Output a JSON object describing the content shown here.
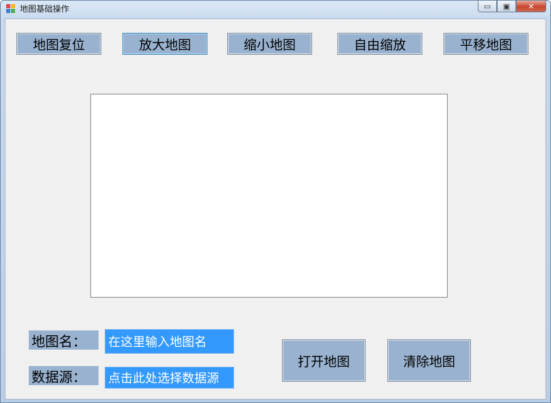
{
  "window": {
    "title": "地图基础操作",
    "min_glyph": "▭",
    "max_glyph": "▣",
    "close_glyph": "✕"
  },
  "toolbar": {
    "reset_label": "地图复位",
    "zoom_in_label": "放大地图",
    "zoom_out_label": "缩小地图",
    "free_zoom_label": "自由缩放",
    "pan_label": "平移地图"
  },
  "form": {
    "map_name_label": "地图名：",
    "map_name_value": "在这里输入地图名",
    "data_source_label": "数据源：",
    "data_source_value": "点击此处选择数据源"
  },
  "actions": {
    "open_label": "打开地图",
    "clear_label": "清除地图"
  },
  "colors": {
    "button": "#99b2cf",
    "field_selected": "#3399ff",
    "client_bg": "#f0f0f0"
  }
}
